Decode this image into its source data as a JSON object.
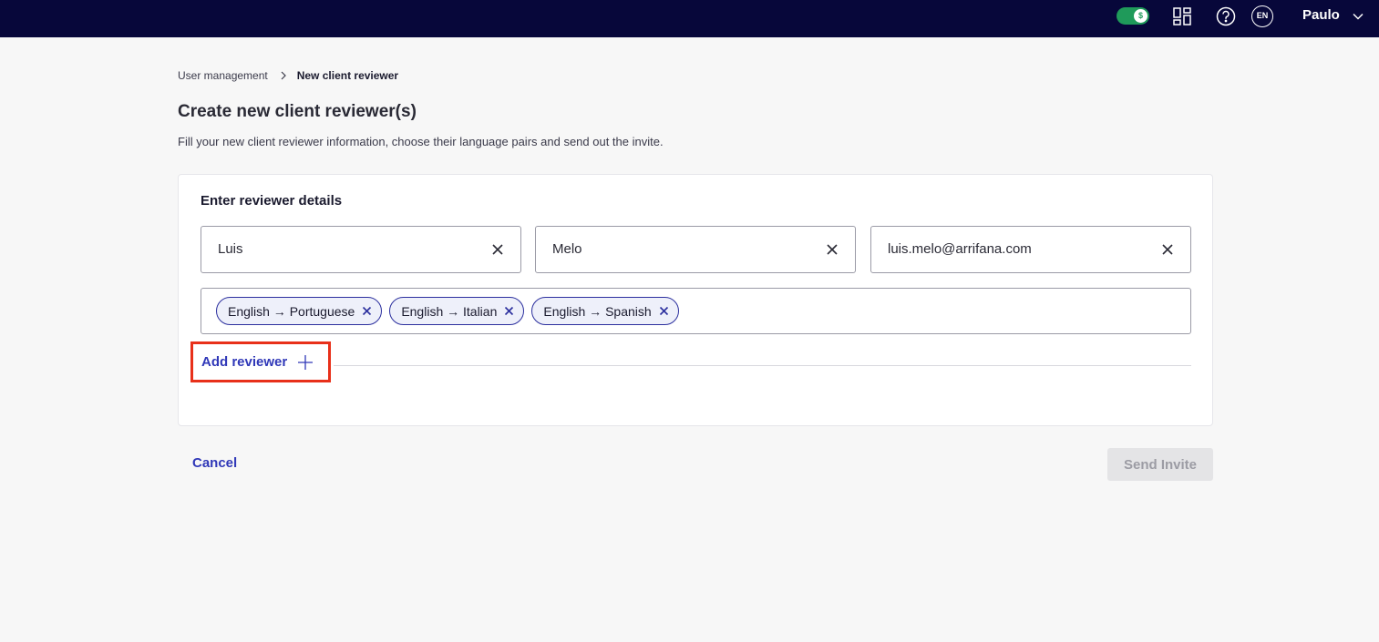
{
  "topbar": {
    "toggle_symbol": "$",
    "lang": "EN",
    "user": "Paulo",
    "icons": [
      "dollar-toggle-icon",
      "dashboard-icon",
      "help-icon",
      "language-icon",
      "chevron-down-icon"
    ]
  },
  "breadcrumb": {
    "parent": "User management",
    "current": "New client reviewer"
  },
  "page": {
    "title": "Create new client reviewer(s)",
    "subtitle": "Fill your new client reviewer information, choose their language pairs and send out the invite."
  },
  "form": {
    "section_title": "Enter reviewer details",
    "first_name": "Luis",
    "last_name": "Melo",
    "email": "luis.melo@arrifana.com",
    "language_pairs": [
      "English → Portuguese",
      "English → Italian",
      "English → Spanish"
    ],
    "add_reviewer_label": "Add reviewer"
  },
  "actions": {
    "cancel_label": "Cancel",
    "send_label": "Send Invite"
  },
  "colors": {
    "topbar": "#07073a",
    "accent": "#3038b8",
    "toggle": "#1f9a5a",
    "highlight": "#e8301a"
  }
}
